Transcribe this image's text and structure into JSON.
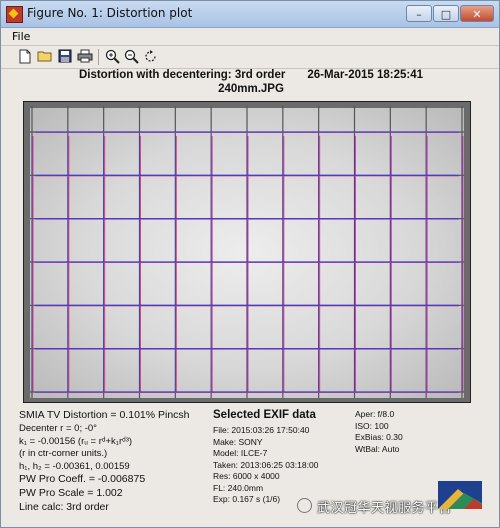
{
  "window": {
    "title": "Figure No. 1: Distortion plot",
    "controls": {
      "minimize": "–",
      "maximize": "□",
      "close": "✕"
    }
  },
  "menu": {
    "file": "File"
  },
  "toolbar": {
    "icons": [
      "new-icon",
      "open-icon",
      "save-icon",
      "print-icon",
      "zoom-in-icon",
      "zoom-out-icon",
      "rotate-icon"
    ]
  },
  "plot": {
    "title_line1_a": "Distortion with decentering:  3rd order",
    "title_line1_b": "26-Mar-2015 18:25:41",
    "title_line2": "240mm.JPG"
  },
  "chart_data": {
    "type": "scatter",
    "title": "Distortion with decentering:  3rd order",
    "grid_lines": {
      "vertical_count": 13,
      "horizontal_count": 7,
      "colors": {
        "ideal": "#d9458a",
        "distorted": "#3a3ad6"
      }
    },
    "distortion_percent": 0.101,
    "distortion_type": "Pincsh"
  },
  "left_info": {
    "smia": "SMIA TV Distortion = 0.101% Pincsh",
    "decenter": "Decenter r = 0;  -0°",
    "k1": "k₁ = -0.00156  (rᵤ = rᵈ+k₁rᵈ³)",
    "rin": "(r in ctr-corner units.)",
    "h": "h₁, h₂ = -0.00361, 0.00159",
    "pw_coeff": "PW Pro Coeff. = -0.006875",
    "pw_scale": "PW Pro Scale = 1.002",
    "line_calc": "Line calc: 3rd order"
  },
  "exif": {
    "header": "Selected EXIF data",
    "file": "File:  2015:03:26 17:50:40",
    "make": "Make:  SONY",
    "model": "Model: ILCE-7",
    "taken": "Taken: 2013:06:25 03:18:00",
    "res": "Res:   6000 x 4000",
    "fl": "FL:  240.0mm",
    "exp": "Exp:   0.167 s  (1/6)"
  },
  "exif_right": {
    "aper": "Aper:  f/8.0",
    "iso": "ISO:   100",
    "exbias": "ExBias:  0.30",
    "wtbal": "WtBal:  Auto"
  },
  "watermark": {
    "text": "武汉冠华天视服务平台"
  }
}
